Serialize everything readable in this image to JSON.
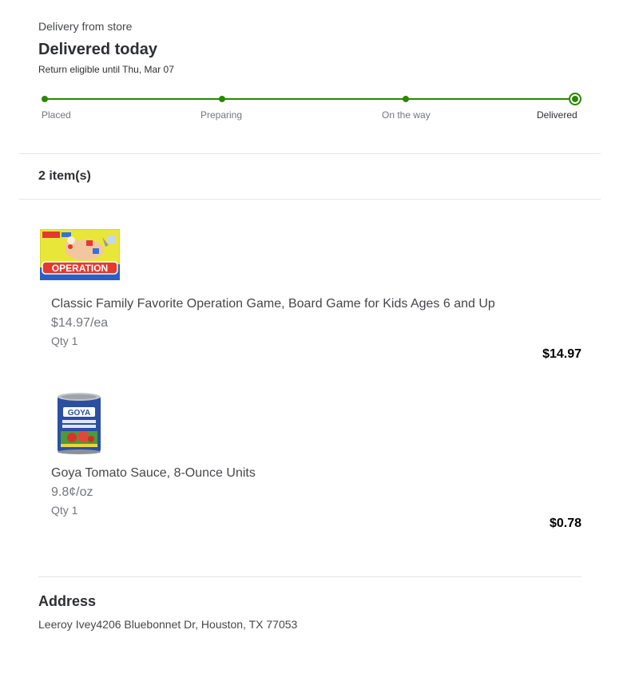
{
  "order": {
    "delivery_method": "Delivery from store",
    "status_title": "Delivered today",
    "return_note": "Return eligible until Thu, Mar 07"
  },
  "tracker": {
    "steps": [
      "Placed",
      "Preparing",
      "On the way",
      "Delivered"
    ],
    "current_step": "Delivered",
    "accent_color": "#2a8703"
  },
  "items": {
    "count_label": "2 item(s)",
    "list": [
      {
        "title": "Classic Family Favorite Operation Game, Board Game for Kids Ages 6 and Up",
        "unit_price": "$14.97/ea",
        "qty": "Qty 1",
        "price": "$14.97",
        "image": "operation-board-game-box",
        "image_text": "OPERATION"
      },
      {
        "title": "Goya Tomato Sauce, 8-Ounce Units",
        "unit_price": "9.8¢/oz",
        "qty": "Qty 1",
        "price": "$0.78",
        "image": "goya-tomato-sauce-can",
        "image_text": "GOYA"
      }
    ]
  },
  "address": {
    "title": "Address",
    "text": "Leeroy Ivey4206 Bluebonnet Dr, Houston, TX 77053"
  }
}
